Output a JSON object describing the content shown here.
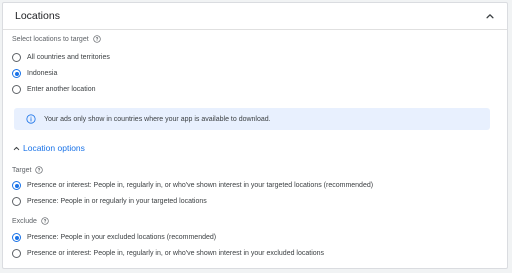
{
  "header": {
    "title": "Locations"
  },
  "select_section": {
    "label": "Select locations to target",
    "options": [
      {
        "label": "All countries and territories",
        "checked": false
      },
      {
        "label": "Indonesia",
        "checked": true
      },
      {
        "label": "Enter another location",
        "checked": false
      }
    ]
  },
  "info_banner": {
    "text": "Your ads only show in countries where your app is available to download."
  },
  "location_options": {
    "toggle_label": "Location options",
    "target": {
      "label": "Target",
      "options": [
        {
          "label": "Presence or interest: People in, regularly in, or who've shown interest in your targeted locations (recommended)",
          "checked": true
        },
        {
          "label": "Presence: People in or regularly in your targeted locations",
          "checked": false
        }
      ]
    },
    "exclude": {
      "label": "Exclude",
      "options": [
        {
          "label": "Presence: People in your excluded locations (recommended)",
          "checked": true
        },
        {
          "label": "Presence or interest: People in, regularly in, or who've shown interest in your excluded locations",
          "checked": false
        }
      ]
    }
  },
  "colors": {
    "accent": "#1a73e8",
    "banner_bg": "#e8f0fe",
    "border": "#dadce0"
  },
  "icons": {
    "collapse": "chevron-up-icon",
    "help": "help-circle-icon",
    "info": "info-icon",
    "options_toggle": "chevron-up-icon"
  }
}
